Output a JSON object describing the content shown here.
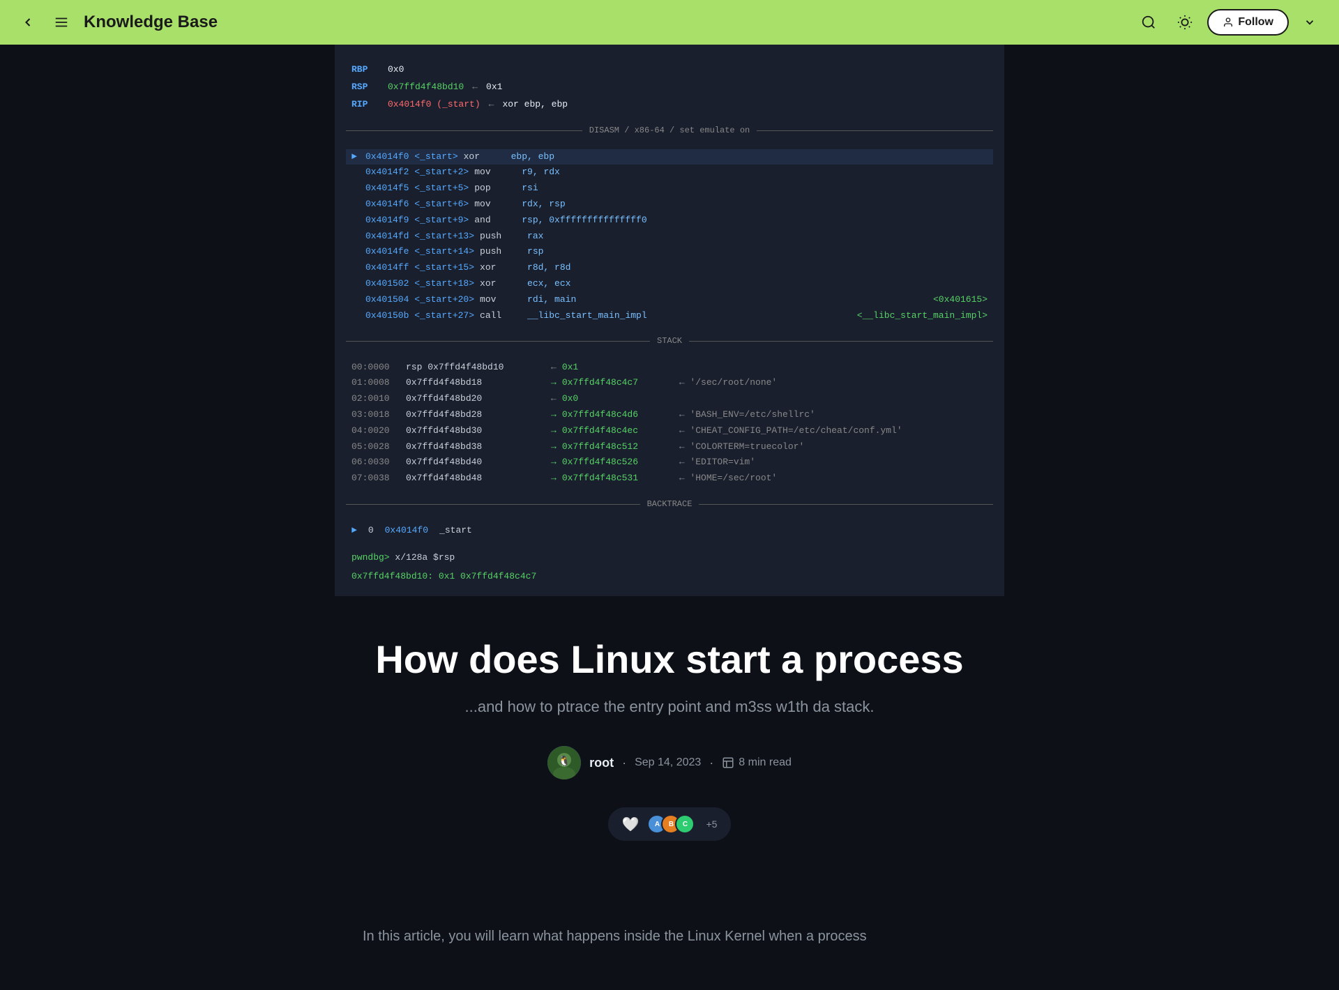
{
  "header": {
    "title": "Knowledge Base",
    "follow_label": "Follow"
  },
  "terminal": {
    "registers": [
      {
        "name": "RBP",
        "value": "0x0",
        "arrow": "",
        "target": ""
      },
      {
        "name": "RSP",
        "value": "0x7ffd4f48bd10",
        "arrow": "← 0x1",
        "target": ""
      },
      {
        "name": "RIP",
        "value": "0x4014f0 (_start)",
        "arrow": "← xor ebp, ebp",
        "target": "",
        "highlight": true
      }
    ],
    "disasm_label": "DISASM / x86-64 / set emulate on",
    "asm_lines": [
      {
        "active": true,
        "addr": "0x4014f0 <_start>",
        "op": "xor",
        "args": "ebp, ebp",
        "target": ""
      },
      {
        "active": false,
        "addr": "0x4014f2 <_start+2>",
        "op": "mov",
        "args": "r9, rdx",
        "target": ""
      },
      {
        "active": false,
        "addr": "0x4014f5 <_start+5>",
        "op": "pop",
        "args": "rsi",
        "target": ""
      },
      {
        "active": false,
        "addr": "0x4014f6 <_start+6>",
        "op": "mov",
        "args": "rdx, rsp",
        "target": ""
      },
      {
        "active": false,
        "addr": "0x4014f9 <_start+9>",
        "op": "and",
        "args": "rsp, 0xfffffffffffffff0",
        "target": ""
      },
      {
        "active": false,
        "addr": "0x4014fd <_start+13>",
        "op": "push",
        "args": "rax",
        "target": ""
      },
      {
        "active": false,
        "addr": "0x4014fe <_start+14>",
        "op": "push",
        "args": "rsp",
        "target": ""
      },
      {
        "active": false,
        "addr": "0x4014ff <_start+15>",
        "op": "xor",
        "args": "r8d, r8d",
        "target": ""
      },
      {
        "active": false,
        "addr": "0x401502 <_start+18>",
        "op": "xor",
        "args": "ecx, ecx",
        "target": ""
      },
      {
        "active": false,
        "addr": "0x401504 <_start+20>",
        "op": "mov",
        "args": "rdi, main",
        "target": "<0x401615>"
      },
      {
        "active": false,
        "addr": "0x40150b <_start+27>",
        "op": "call",
        "args": "__libc_start_main_impl",
        "target": "<__libc_start_main_impl>"
      }
    ],
    "stack_label": "STACK",
    "stack_lines": [
      {
        "idx": "00:0000",
        "addr": "rsp 0x7ffd4f48bd10",
        "arrow": "←",
        "val": "0x1",
        "comment": ""
      },
      {
        "idx": "01:0008",
        "addr": "    0x7ffd4f48bd18",
        "arrow": "→",
        "val": "0x7ffd4f48c4c7",
        "comment": "← '/sec/root/none'"
      },
      {
        "idx": "02:0010",
        "addr": "    0x7ffd4f48bd20",
        "arrow": "←",
        "val": "0x0",
        "comment": ""
      },
      {
        "idx": "03:0018",
        "addr": "    0x7ffd4f48bd28",
        "arrow": "→",
        "val": "0x7ffd4f48c4d6",
        "comment": "← 'BASH_ENV=/etc/shellrc'"
      },
      {
        "idx": "04:0020",
        "addr": "    0x7ffd4f48bd30",
        "arrow": "→",
        "val": "0x7ffd4f48c4ec",
        "comment": "← 'CHEAT_CONFIG_PATH=/etc/cheat/conf.yml'"
      },
      {
        "idx": "05:0028",
        "addr": "    0x7ffd4f48bd38",
        "arrow": "→",
        "val": "0x7ffd4f48c512",
        "comment": "← 'COLORTERM=truecolor'"
      },
      {
        "idx": "06:0030",
        "addr": "    0x7ffd4f48bd40",
        "arrow": "→",
        "val": "0x7ffd4f48c526",
        "comment": "← 'EDITOR=vim'"
      },
      {
        "idx": "07:0038",
        "addr": "    0x7ffd4f48bd48",
        "arrow": "→",
        "val": "0x7ffd4f48c531",
        "comment": "← 'HOME=/sec/root'"
      }
    ],
    "backtrace_label": "BACKTRACE",
    "backtrace_lines": [
      {
        "num": "0",
        "addr": "0x4014f0",
        "name": "_start"
      }
    ],
    "prompt": "pwndbg>",
    "command": "x/128a $rsp",
    "hex_output": "0x7ffd4f48bd10:  0x1     0x7ffd4f48c4c7"
  },
  "article": {
    "title": "How does Linux start a process",
    "subtitle": "...and how to ptrace the entry point and m3ss w1th da stack.",
    "author": {
      "name": "root",
      "avatar_emoji": "🐧"
    },
    "date": "Sep 14, 2023",
    "read_time": "8 min read",
    "reaction_count": "+5",
    "body_text": "In this article, you will learn what happens inside the Linux Kernel when a process"
  },
  "icons": {
    "back": "‹",
    "menu": "☰",
    "search": "🔍",
    "theme": "☀",
    "person": "👤",
    "chevron_down": "⌄",
    "book": "📖",
    "heart": "🤍"
  }
}
